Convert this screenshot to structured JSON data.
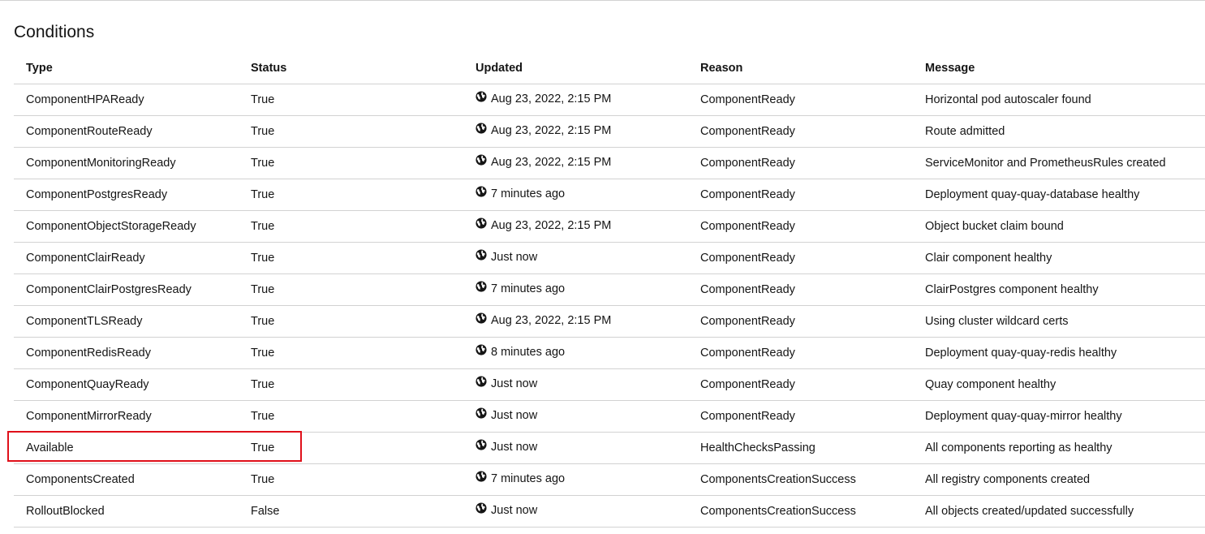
{
  "section": {
    "title": "Conditions"
  },
  "table": {
    "headers": {
      "type": "Type",
      "status": "Status",
      "updated": "Updated",
      "reason": "Reason",
      "message": "Message"
    },
    "rows": [
      {
        "type": "ComponentHPAReady",
        "status": "True",
        "updated": "Aug 23, 2022, 2:15 PM",
        "reason": "ComponentReady",
        "message": "Horizontal pod autoscaler found"
      },
      {
        "type": "ComponentRouteReady",
        "status": "True",
        "updated": "Aug 23, 2022, 2:15 PM",
        "reason": "ComponentReady",
        "message": "Route admitted"
      },
      {
        "type": "ComponentMonitoringReady",
        "status": "True",
        "updated": "Aug 23, 2022, 2:15 PM",
        "reason": "ComponentReady",
        "message": "ServiceMonitor and PrometheusRules created"
      },
      {
        "type": "ComponentPostgresReady",
        "status": "True",
        "updated": "7 minutes ago",
        "reason": "ComponentReady",
        "message": "Deployment quay-quay-database healthy"
      },
      {
        "type": "ComponentObjectStorageReady",
        "status": "True",
        "updated": "Aug 23, 2022, 2:15 PM",
        "reason": "ComponentReady",
        "message": "Object bucket claim bound"
      },
      {
        "type": "ComponentClairReady",
        "status": "True",
        "updated": "Just now",
        "reason": "ComponentReady",
        "message": "Clair component healthy"
      },
      {
        "type": "ComponentClairPostgresReady",
        "status": "True",
        "updated": "7 minutes ago",
        "reason": "ComponentReady",
        "message": "ClairPostgres component healthy"
      },
      {
        "type": "ComponentTLSReady",
        "status": "True",
        "updated": "Aug 23, 2022, 2:15 PM",
        "reason": "ComponentReady",
        "message": "Using cluster wildcard certs"
      },
      {
        "type": "ComponentRedisReady",
        "status": "True",
        "updated": "8 minutes ago",
        "reason": "ComponentReady",
        "message": "Deployment quay-quay-redis healthy"
      },
      {
        "type": "ComponentQuayReady",
        "status": "True",
        "updated": "Just now",
        "reason": "ComponentReady",
        "message": "Quay component healthy"
      },
      {
        "type": "ComponentMirrorReady",
        "status": "True",
        "updated": "Just now",
        "reason": "ComponentReady",
        "message": "Deployment quay-quay-mirror healthy"
      },
      {
        "type": "Available",
        "status": "True",
        "updated": "Just now",
        "reason": "HealthChecksPassing",
        "message": "All components reporting as healthy"
      },
      {
        "type": "ComponentsCreated",
        "status": "True",
        "updated": "7 minutes ago",
        "reason": "ComponentsCreationSuccess",
        "message": "All registry components created"
      },
      {
        "type": "RolloutBlocked",
        "status": "False",
        "updated": "Just now",
        "reason": "ComponentsCreationSuccess",
        "message": "All objects created/updated successfully"
      }
    ]
  },
  "icons": {
    "updated": "globe-icon"
  },
  "colors": {
    "highlight": "#e0101a",
    "divider": "#d2d2d2",
    "text": "#151515"
  }
}
